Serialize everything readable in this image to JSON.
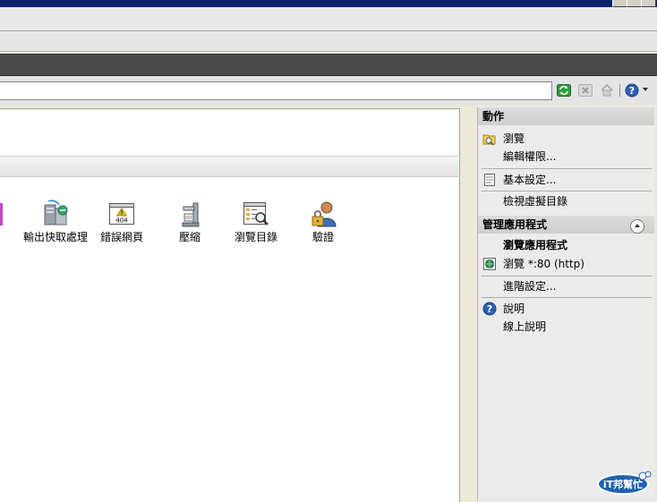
{
  "toolbar": {
    "refresh_icon": "refresh-icon",
    "stop_icon": "stop-icon",
    "home_icon": "home-icon",
    "help_icon": "help-icon"
  },
  "features": [
    {
      "label": "輸出快取處理",
      "icon": "output-cache-icon"
    },
    {
      "label": "錯誤網頁",
      "icon": "error-pages-icon"
    },
    {
      "label": "壓縮",
      "icon": "compression-icon"
    },
    {
      "label": "瀏覽目錄",
      "icon": "directory-browsing-icon"
    },
    {
      "label": "驗證",
      "icon": "authentication-icon"
    }
  ],
  "actions": {
    "header": "動作",
    "explore": "瀏覽",
    "edit_permissions": "編輯權限...",
    "basic_settings": "基本設定...",
    "view_virtual_dirs": "檢視虛擬目錄",
    "manage_app_header": "管理應用程式",
    "browse_app_title": "瀏覽應用程式",
    "browse_port": "瀏覽 *:80 (http)",
    "advanced_settings": "進階設定...",
    "help": "說明",
    "online_help": "線上說明"
  },
  "watermark": {
    "text": "iT邦幫忙"
  },
  "colors": {
    "nav_dark": "#4a4a4a",
    "accent_purple": "#b84dc0",
    "help_blue": "#2c5fb3"
  }
}
